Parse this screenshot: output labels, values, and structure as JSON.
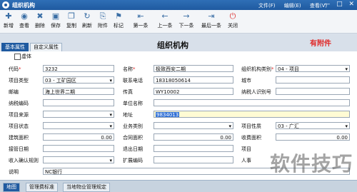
{
  "window": {
    "title": "组织机构",
    "menus": [
      "文件(F)",
      "编辑(E)",
      "查看(V)"
    ],
    "controls": [
      "—",
      "□",
      "✕"
    ]
  },
  "toolbar": [
    {
      "label": "新增",
      "icon": "new-icon",
      "glyph": "✚"
    },
    {
      "label": "查看",
      "icon": "view-icon",
      "glyph": "◉"
    },
    {
      "label": "删除",
      "icon": "delete-icon",
      "glyph": "✖"
    },
    {
      "label": "保存",
      "icon": "save-icon",
      "glyph": "▣"
    },
    {
      "label": "复制",
      "icon": "copy-icon",
      "glyph": "❐"
    },
    {
      "label": "刷新",
      "icon": "refresh-icon",
      "glyph": "↻"
    },
    {
      "label": "附件",
      "icon": "attachment-icon",
      "glyph": "⎘"
    },
    {
      "label": "标记",
      "icon": "mark-icon",
      "glyph": "⚑"
    },
    {
      "label": "第一条",
      "icon": "first-icon",
      "glyph": "⇤"
    },
    {
      "label": "上一条",
      "icon": "prev-icon",
      "glyph": "←"
    },
    {
      "label": "下一条",
      "icon": "next-icon",
      "glyph": "→"
    },
    {
      "label": "最后一条",
      "icon": "last-icon",
      "glyph": "⇥"
    },
    {
      "label": "关闭",
      "icon": "close-icon",
      "glyph": "⏻"
    }
  ],
  "tabs": [
    "基本属性",
    "自定义属性"
  ],
  "heading": "组织机构",
  "attachment_note": "有附件",
  "form": {
    "disabled_label": "虚体",
    "code_label": "代码",
    "code_value": "3232",
    "name_label": "名称",
    "name_value": "极致西安二期",
    "org_type_label": "组织机构类别",
    "org_type_value": "04 - 项目",
    "project_type_label": "项目类型",
    "project_type_value": "03 - 工矿园区",
    "phone_label": "联系电话",
    "phone_value": "18318050614",
    "city_label": "城市",
    "postcode_label": "邮编",
    "postcode_value": "海上世界二期",
    "fax_label": "传真",
    "fax_value": "WY10002",
    "taxpayer_label": "纳税人识别号",
    "tax_code_label": "纳税编码",
    "company_label": "单位名称",
    "source_label": "项目来源",
    "address_label": "地址",
    "address_value": "9834013",
    "status_label": "项目状态",
    "biz_type_label": "业务类别",
    "nature_label": "项目性质",
    "nature_value": "03 - 广汇",
    "build_area_label": "建筑面积",
    "build_area_value": "0.00",
    "contract_area_label": "合同面积",
    "contract_area_value": "0.00",
    "charge_area_label": "收费面积",
    "charge_area_value": "0.00",
    "takeover_label": "接管日期",
    "exit_label": "退出日期",
    "project_label": "项目",
    "revenue_label": "收入确认规则",
    "ext_code_label": "扩展编码",
    "person_label": "人事",
    "desc_label": "说明",
    "desc_value": "NC银行"
  },
  "bottom_tabs": [
    "地图",
    "管理费标准",
    "当地物业管理规定"
  ],
  "watermark": "软件技巧"
}
